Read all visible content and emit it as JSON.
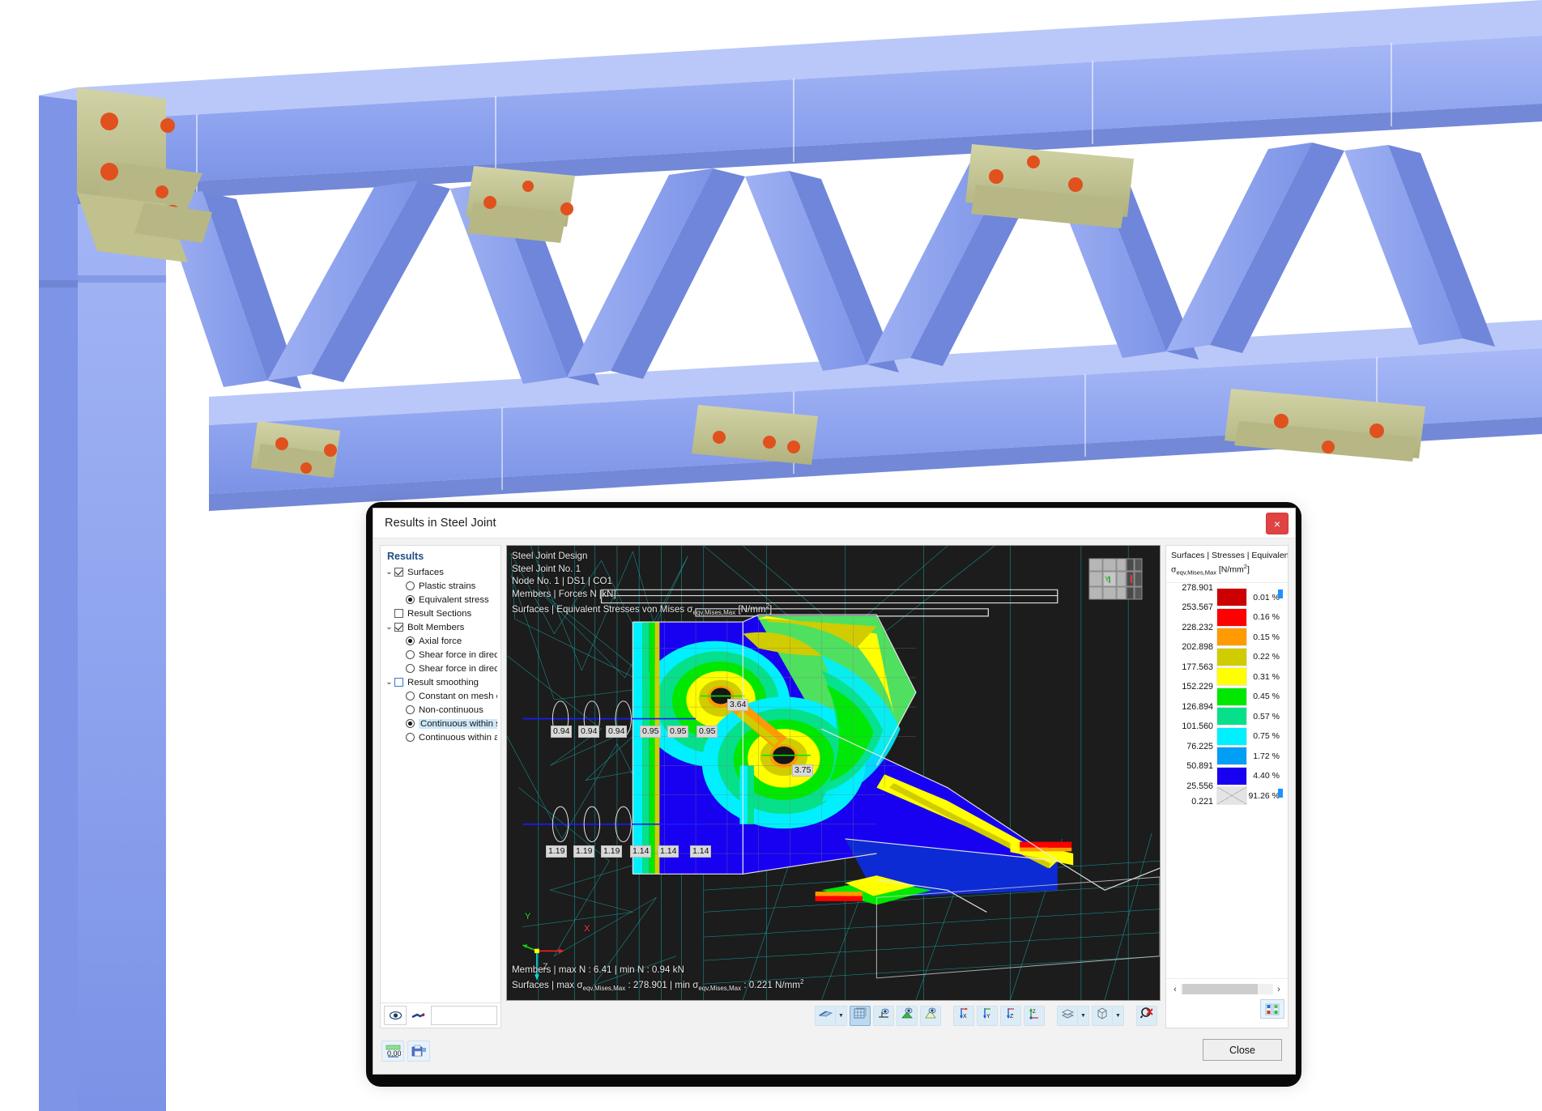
{
  "window": {
    "title": "Results in Steel Joint",
    "close_icon": "close-icon",
    "close_label": "×"
  },
  "results_panel": {
    "header": "Results",
    "tree": [
      {
        "label": "Surfaces",
        "level": 0,
        "control": "checkbox",
        "state": "checked",
        "twisty": "⌄"
      },
      {
        "label": "Plastic strains",
        "level": 1,
        "control": "radio",
        "state": "off"
      },
      {
        "label": "Equivalent stress",
        "level": 1,
        "control": "radio",
        "state": "on"
      },
      {
        "label": "Result Sections",
        "level": 0,
        "control": "checkbox",
        "state": "unchecked",
        "twisty": ""
      },
      {
        "label": "Bolt Members",
        "level": 0,
        "control": "checkbox",
        "state": "checked",
        "twisty": "⌄"
      },
      {
        "label": "Axial force",
        "level": 1,
        "control": "radio",
        "state": "on"
      },
      {
        "label": "Shear force in directi…",
        "level": 1,
        "control": "radio",
        "state": "off"
      },
      {
        "label": "Shear force in directi…",
        "level": 1,
        "control": "radio",
        "state": "off"
      },
      {
        "label": "Result smoothing",
        "level": 0,
        "control": "checkbox",
        "state": "blue",
        "twisty": "⌄"
      },
      {
        "label": "Constant on mesh el…",
        "level": 1,
        "control": "radio",
        "state": "off"
      },
      {
        "label": "Non-continuous",
        "level": 1,
        "control": "radio",
        "state": "off"
      },
      {
        "label": "Continuous within su…",
        "level": 1,
        "control": "radio",
        "state": "on",
        "selected": true
      },
      {
        "label": "Continuous within all…",
        "level": 1,
        "control": "radio",
        "state": "off"
      }
    ],
    "footer_icons": [
      "eye-icon",
      "deformation-icon"
    ]
  },
  "viewport": {
    "info_lines": [
      "Steel Joint Design",
      "Steel Joint No. 1",
      "Node No. 1 | DS1 | CO1",
      "Members | Forces N [kN]"
    ],
    "info_line_surfaces_prefix": "Surfaces | Equivalent Stresses von Mises σ",
    "info_line_surfaces_sub": "eqv,Mises,Max",
    "info_line_surfaces_unit": " [N/mm",
    "info_line_surfaces_sup": "2",
    "info_line_surfaces_tail": "]",
    "status_members": "Members | max N : 6.41 | min N : 0.94 kN",
    "status_surfaces_prefix": "Surfaces | max σ",
    "status_surfaces_sub1": "eqv,Mises,Max",
    "status_surfaces_mid": " : 278.901 | min σ",
    "status_surfaces_sub2": "eqv,Mises,Max",
    "status_surfaces_tail": " : 0.221 N/mm",
    "status_surfaces_sup": "2",
    "axis_labels": {
      "x": "X",
      "y": "Y",
      "z": "Z"
    },
    "member_force_tags_row1": [
      "0.94",
      "0.94",
      "0.94",
      "0.95",
      "0.95",
      "0.95"
    ],
    "member_force_tags_row2": [
      "1.19",
      "1.19",
      "1.19",
      "1.14",
      "1.14",
      "1.14"
    ],
    "bolt_tags": [
      "3.64",
      "3.75"
    ],
    "toolbar": [
      {
        "name": "render-mode-button",
        "icon": "shaded-icon",
        "has_split": true,
        "active": false
      },
      {
        "name": "wireframe-button",
        "icon": "grid-cube-icon",
        "has_split": false,
        "active": true
      },
      {
        "name": "support-view-button",
        "icon": "support-eye-icon",
        "has_split": false,
        "active": false
      },
      {
        "name": "load-view-button",
        "icon": "load-eye-icon",
        "has_split": false,
        "active": false
      },
      {
        "name": "surface-view-button",
        "icon": "surface-eye-icon",
        "has_split": false,
        "active": false
      },
      {
        "name": "view-in-x-button",
        "icon": "axis-x-icon",
        "has_split": false,
        "active": false
      },
      {
        "name": "view-in-y-button",
        "icon": "axis-y-icon",
        "has_split": false,
        "active": false
      },
      {
        "name": "view-in-z-button",
        "icon": "axis-z-icon",
        "has_split": false,
        "active": false
      },
      {
        "name": "view-isometric-button",
        "icon": "axis-zx-icon",
        "has_split": false,
        "active": false
      },
      {
        "name": "section-button",
        "icon": "layers-icon",
        "has_split": true,
        "active": false
      },
      {
        "name": "perspective-button",
        "icon": "cube-icon",
        "has_split": true,
        "active": false
      },
      {
        "name": "clear-results-button",
        "icon": "magnifier-x-icon",
        "has_split": false,
        "active": false
      }
    ]
  },
  "legend": {
    "title_line1": "Surfaces | Stresses | Equivalent St",
    "title_sigma": "σ",
    "title_sub": "eqv,Mises,Max",
    "title_unit": " [N/mm",
    "title_sup": "2",
    "title_tail": "]",
    "values": [
      "278.901",
      "253.567",
      "228.232",
      "202.898",
      "177.563",
      "152.229",
      "126.894",
      "101.560",
      "76.225",
      "50.891",
      "25.556",
      "0.221"
    ],
    "colors": [
      "#cc0000",
      "#fe0000",
      "#ff9a00",
      "#d0cc00",
      "#ffff00",
      "#00e800",
      "#06e08a",
      "#00f0ff",
      "#009ef5",
      "#1800f0",
      "#e4e4e4"
    ],
    "percents": [
      "0.01 %",
      "0.16 %",
      "0.15 %",
      "0.22 %",
      "0.31 %",
      "0.45 %",
      "0.57 %",
      "0.75 %",
      "1.72 %",
      "4.40 %",
      "91.26 %"
    ],
    "scroll_left_icon": "chevron-left-icon",
    "scroll_right_icon": "chevron-right-icon",
    "config_icon": "legend-settings-icon"
  },
  "dialog_footer": {
    "icons": [
      "numeric-format-icon",
      "printout-icon"
    ],
    "close_label": "Close"
  },
  "model": {
    "member_color": "#8fa4ef",
    "member_color_light": "#a6b7f4",
    "member_color_dark": "#6f86da",
    "plate_color": "#c6c795",
    "plate_color_dark": "#aaab78",
    "bolt_color": "#e0511e"
  }
}
